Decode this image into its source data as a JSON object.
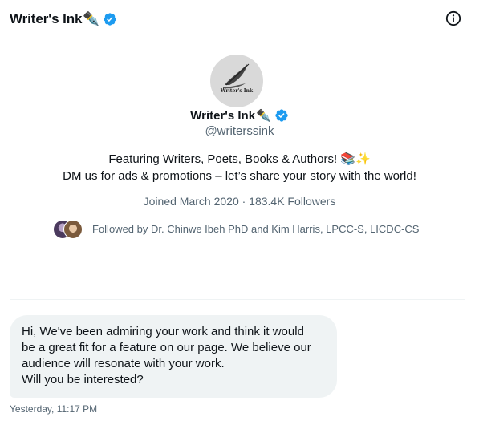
{
  "header": {
    "title": "Writer's Ink",
    "title_emoji": "✒️",
    "verified_icon": "verified-badge-icon",
    "info_icon": "info-icon"
  },
  "profile": {
    "avatar_label": "Writer's Ink",
    "name": "Writer's Ink",
    "name_emoji": "✒️",
    "handle": "@writerssink",
    "bio_line_1": "Featuring Writers, Poets, Books & Authors! 📚✨",
    "bio_line_2": "DM us for ads & promotions – let’s share your story with the world!",
    "joined": "Joined March 2020 · 183.4K Followers",
    "followed_by": "Followed by Dr. Chinwe Ibeh PhD and Kim Harris, LPCC-S, LICDC-CS"
  },
  "message": {
    "lines": [
      "Hi, We've been admiring your work and think it would",
      "be a great fit for a feature on our page. We believe our",
      "audience will resonate with your work.",
      "Will you be interested?"
    ],
    "timestamp": "Yesterday, 11:17 PM"
  },
  "colors": {
    "verified_blue": "#1d9bf0",
    "secondary_text": "#536471",
    "bubble_bg": "#eff3f4",
    "divider": "#eff3f4",
    "text": "#0f1419"
  }
}
